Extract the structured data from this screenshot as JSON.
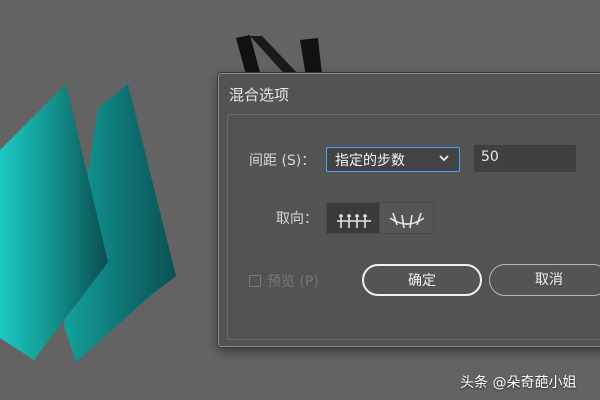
{
  "dialog": {
    "title": "混合选项",
    "spacing_label": "间距 (S)：",
    "spacing_value": "指定的步数",
    "steps_value": "50",
    "orientation_label": "取向：",
    "preview_label": "预览 (P)",
    "preview_checked": false,
    "ok_label": "确定",
    "cancel_label": "取消"
  },
  "watermark": "头条 @朵奇葩小姐",
  "colors": {
    "canvas": "#636363",
    "dialog": "#535353",
    "accent": "#4ea0ff",
    "teal_light": "#1bbdb6",
    "teal_dark": "#0a5557"
  },
  "icons": {
    "dropdown": "chevron-down-icon",
    "orient_page": "align-to-page-icon",
    "orient_path": "align-to-path-icon"
  }
}
